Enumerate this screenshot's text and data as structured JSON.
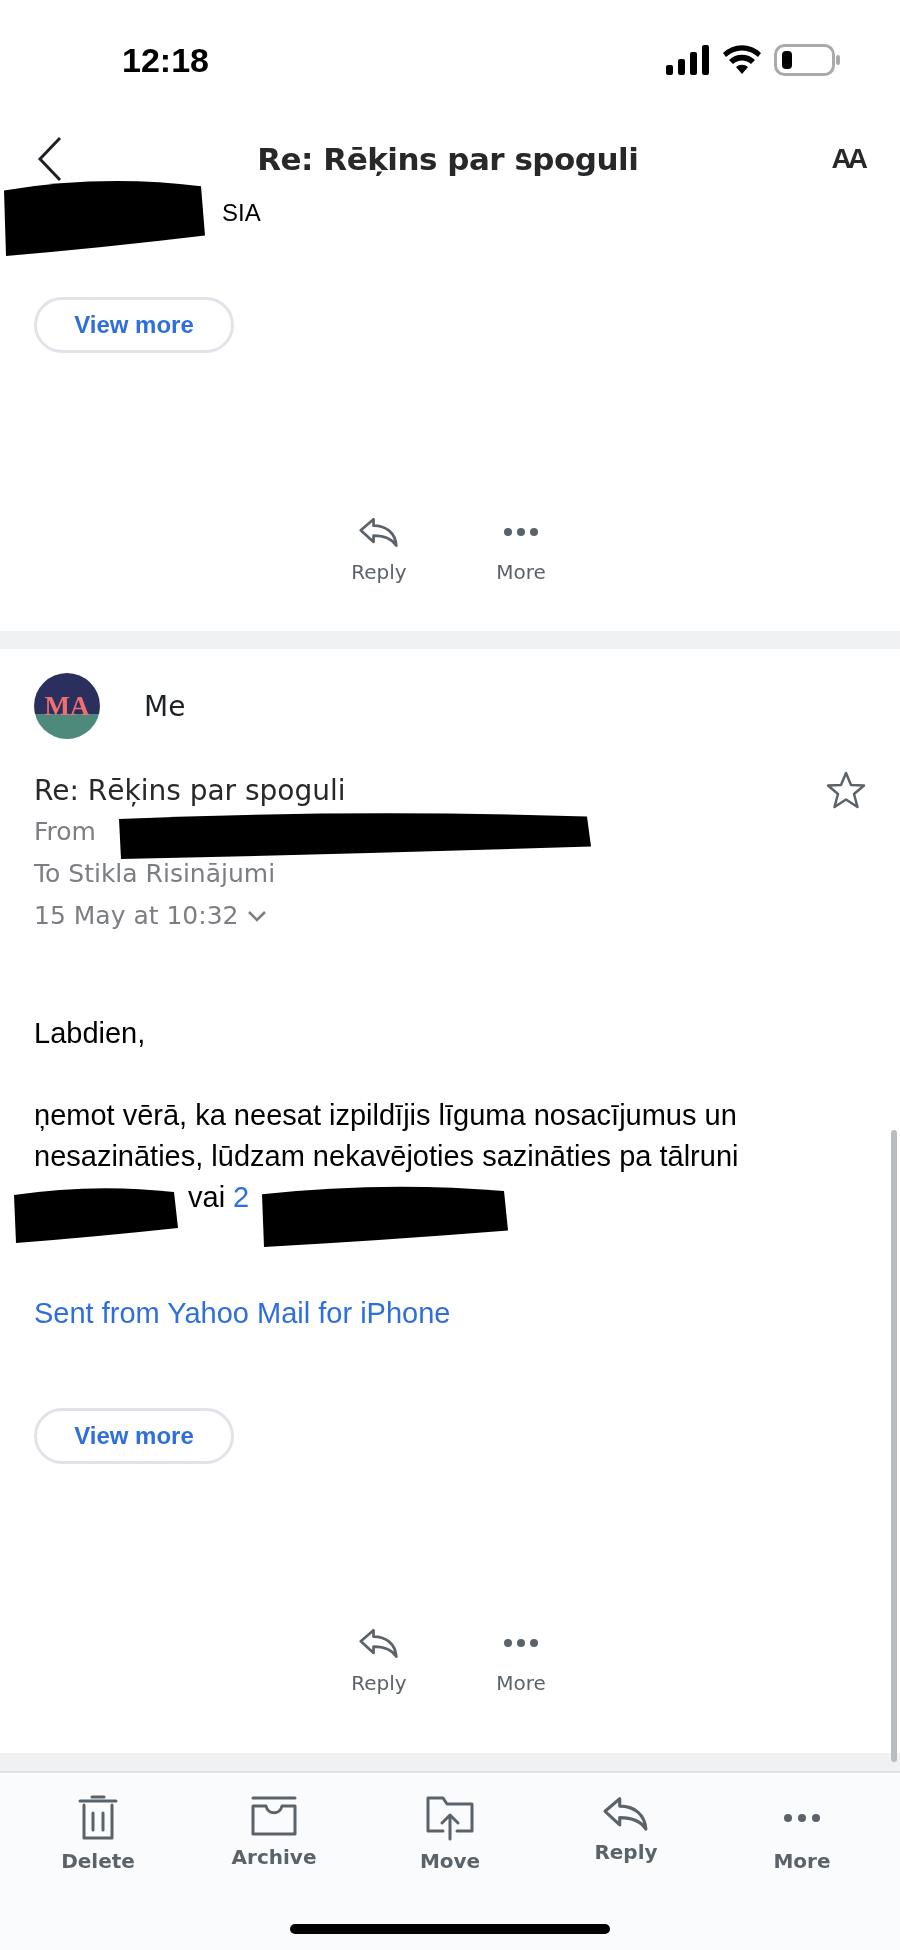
{
  "status_bar": {
    "time": "12:18"
  },
  "nav": {
    "title": "Re: Rēķins par spoguli",
    "text_size_label": "AA"
  },
  "messages": [
    {
      "sender_line": "SIA",
      "view_more": "View more",
      "actions": [
        "Reply",
        "More"
      ]
    },
    {
      "avatar": "MA",
      "sender": "Me",
      "subject": "Re: Rēķins par spoguli",
      "starred": false,
      "from": "From",
      "to": "To Stikla Risinājumi",
      "date": "15 May at 10:32",
      "greeting": "Labdien,",
      "paragraph": "ņemot vērā, ka neesat izpildījis līguma nosacījumus un nesazināties, lūdzam nekavējoties sazināties pa tālruni",
      "after_redaction": "vai",
      "phone_link": "2",
      "signature": "Sent from Yahoo Mail for iPhone",
      "view_more": "View more",
      "actions": [
        "Reply",
        "More"
      ]
    }
  ],
  "toolbar": [
    {
      "kind": "delete",
      "label": "Delete"
    },
    {
      "kind": "archive",
      "label": "Archive"
    },
    {
      "kind": "move",
      "label": "Move"
    },
    {
      "kind": "reply",
      "label": "Reply"
    },
    {
      "kind": "more",
      "label": "More"
    }
  ]
}
